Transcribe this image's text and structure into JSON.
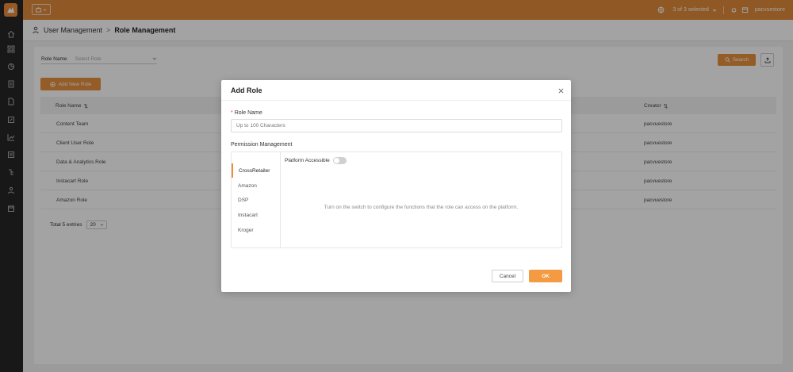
{
  "colors": {
    "accent": "#e8903e",
    "topbar": "#e08a3a",
    "sidebar": "#262626"
  },
  "topbar": {
    "selected": "3 of 3 selected",
    "user": "pacvuestore"
  },
  "breadcrumb": {
    "parent": "User Management",
    "separator": ">",
    "current": "Role Management"
  },
  "filter": {
    "label": "Role Name",
    "placeholder": "Select Role"
  },
  "buttons": {
    "search": "Search",
    "add_role": "Add New Role"
  },
  "table": {
    "columns": [
      "Role Name",
      "Creator"
    ],
    "rows": [
      {
        "name": "Content Team",
        "creator": "pacvuestore"
      },
      {
        "name": "Client User Role",
        "creator": "pacvuestore"
      },
      {
        "name": "Data & Analytics Role",
        "creator": "pacvuestore"
      },
      {
        "name": "Instacart Role",
        "creator": "pacvuestore"
      },
      {
        "name": "Amazon Role",
        "creator": "pacvuestore"
      }
    ],
    "total": "Total 5 entries",
    "page_size": "20"
  },
  "modal": {
    "title": "Add Role",
    "role_name_label": "Role Name",
    "required_mark": "*",
    "role_name_placeholder": "Up to 100 Characters",
    "permission_label": "Permission Management",
    "platforms": [
      "CrossRetailer",
      "Amazon",
      "DSP",
      "Instacart",
      "Kroger"
    ],
    "active_platform": "CrossRetailer",
    "platform_access_label": "Platform Accessible",
    "platform_access_on": false,
    "hint": "Turn on the switch to configure the functions that the role can access on the platform.",
    "cancel": "Cancel",
    "ok": "OK"
  }
}
